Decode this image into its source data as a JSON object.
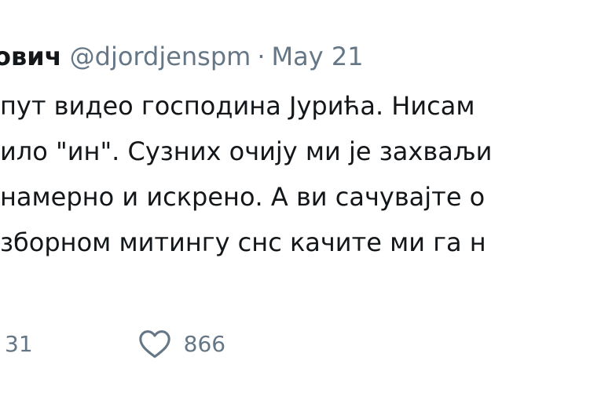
{
  "tweet": {
    "author": {
      "display_name": "ович",
      "handle": "@djordjenspm"
    },
    "separator": "·",
    "date": "May 21",
    "lines": [
      "пут видео господина Јурића. Нисам",
      "ило \"ин\". Сузних очију ми је захваљи",
      "намерно и искрено. А ви сачувајте о",
      "зборном митингу снс качите ми га н"
    ],
    "actions": {
      "retweet_count": "31",
      "like_count": "866"
    }
  },
  "icons": {
    "like": "heart-outline-icon"
  },
  "colors": {
    "text": "#14171a",
    "muted": "#657786"
  }
}
